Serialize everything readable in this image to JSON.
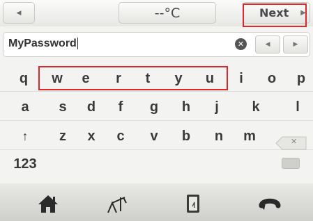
{
  "topbar": {
    "left_arrow": "◀",
    "temperature": "--°C",
    "next_label": "Next",
    "next_arrow": "▶"
  },
  "field": {
    "value": "MyPassword",
    "clear_icon": "✕",
    "left_arrow": "◀",
    "right_arrow": "▶"
  },
  "keyboard": {
    "row1": [
      "q",
      "w",
      "e",
      "r",
      "t",
      "y",
      "u",
      "i",
      "o",
      "p"
    ],
    "row2": [
      "a",
      "s",
      "d",
      "f",
      "g",
      "h",
      "j",
      "k",
      "l"
    ],
    "row3": [
      "↑",
      "z",
      "x",
      "c",
      "v",
      "b",
      "n",
      "m"
    ],
    "mode_key": "123",
    "backspace_icon": "✕"
  },
  "bottombar": {
    "icons": [
      "home-icon",
      "scale-icon",
      "note-icon",
      "back-icon"
    ]
  },
  "colors": {
    "highlight": "#e2262b"
  }
}
